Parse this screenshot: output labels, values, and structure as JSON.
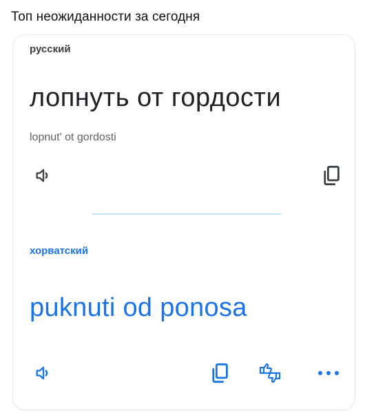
{
  "caption": "Топ неожиданности за сегодня",
  "source": {
    "language": "русский",
    "text": "лопнуть от гордости",
    "transliteration": "lopnut' ot gordosti",
    "icons": [
      "speaker-icon",
      "copy-icon"
    ]
  },
  "target": {
    "language": "хорватский",
    "text": "puknuti od ponosa",
    "icons": [
      "speaker-icon",
      "copy-icon",
      "feedback-icon",
      "more-icon"
    ]
  },
  "colors": {
    "accent": "#1a73e8",
    "source_text": "#202124",
    "secondary_text": "#5f6368",
    "divider": "#c7e3f7"
  }
}
